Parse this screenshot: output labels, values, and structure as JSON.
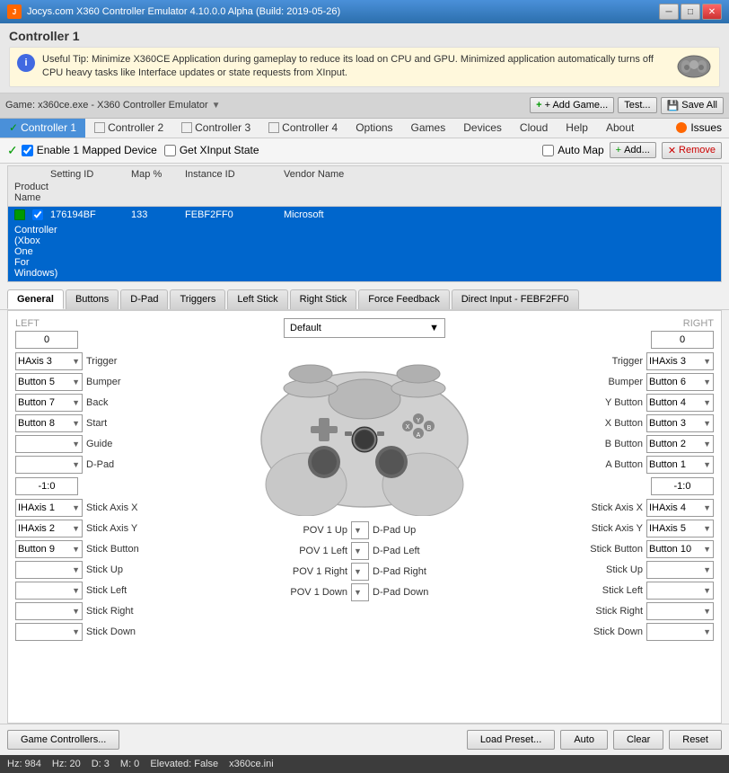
{
  "titleBar": {
    "title": "Jocys.com X360 Controller Emulator 4.10.0.0 Alpha (Build: 2019-05-26)",
    "minBtn": "─",
    "maxBtn": "□",
    "closeBtn": "✕"
  },
  "controllerHeader": {
    "title": "Controller 1",
    "tipText": "Useful Tip: Minimize X360CE Application during gameplay to reduce its load on CPU and GPU. Minimized application automatically turns off CPU heavy tasks like Interface updates or state requests from XInput.",
    "tipPrefix": "i"
  },
  "toolbar": {
    "gameLabel": "Game: x360ce.exe - X360 Controller Emulator",
    "addGameBtn": "+ Add Game...",
    "testBtn": "Test...",
    "saveAllBtn": "Save All"
  },
  "menuBar": {
    "items": [
      "Controller 1",
      "Controller 2",
      "Controller 3",
      "Controller 4",
      "Options",
      "Games",
      "Devices",
      "Cloud",
      "Help",
      "About"
    ],
    "issuesLabel": "Issues"
  },
  "actionBar": {
    "enableLabel": "Enable 1 Mapped Device",
    "getXInputLabel": "Get XInput State",
    "autoMapLabel": "Auto Map",
    "addLabel": "Add...",
    "removeLabel": "Remove"
  },
  "deviceTable": {
    "headers": [
      "",
      "",
      "Setting ID",
      "Map %",
      "Instance ID",
      "Vendor Name",
      "Product Name"
    ],
    "row": {
      "settingId": "176194BF",
      "mapPercent": "133",
      "instanceId": "FEBF2FF0",
      "vendorName": "Microsoft",
      "productName": "Controller (Xbox One For Windows)"
    }
  },
  "tabs": {
    "items": [
      "General",
      "Buttons",
      "D-Pad",
      "Triggers",
      "Left Stick",
      "Right Stick",
      "Force Feedback",
      "Direct Input - FEBF2FF0"
    ],
    "activeTab": "General"
  },
  "leftPanel": {
    "title": "LEFT",
    "inputValue": "0",
    "stickValue": "-1:0",
    "rows": [
      {
        "dropdown": "HAxis 3",
        "label": "Trigger"
      },
      {
        "dropdown": "Button 5",
        "label": "Bumper"
      },
      {
        "dropdown": "Button 7",
        "label": "Back"
      },
      {
        "dropdown": "Button 8",
        "label": "Start"
      },
      {
        "dropdown": "",
        "label": "Guide"
      },
      {
        "dropdown": "",
        "label": "D-Pad"
      },
      {
        "dropdown": "IHAxis 1",
        "label": "Stick Axis X"
      },
      {
        "dropdown": "IHAxis 2",
        "label": "Stick Axis Y"
      },
      {
        "dropdown": "Button 9",
        "label": "Stick Button"
      },
      {
        "dropdown": "",
        "label": "Stick Up"
      },
      {
        "dropdown": "",
        "label": "Stick Left"
      },
      {
        "dropdown": "",
        "label": "Stick Right"
      },
      {
        "dropdown": "",
        "label": "Stick Down"
      }
    ]
  },
  "centerPanel": {
    "defaultDropdown": "Default",
    "dpadRows": [
      {
        "label": "POV 1 Up",
        "value": "D-Pad Up"
      },
      {
        "label": "POV 1 Left",
        "value": "D-Pad Left"
      },
      {
        "label": "POV 1 Right",
        "value": "D-Pad Right"
      },
      {
        "label": "POV 1 Down",
        "value": "D-Pad Down"
      }
    ]
  },
  "rightPanel": {
    "title": "RIGHT",
    "inputValue": "0",
    "stickValue": "-1:0",
    "rows": [
      {
        "label": "Trigger",
        "dropdown": "IHAxis 3"
      },
      {
        "label": "Bumper",
        "dropdown": "Button 6"
      },
      {
        "label": "Y Button",
        "dropdown": "Button 4"
      },
      {
        "label": "X Button",
        "dropdown": "Button 3"
      },
      {
        "label": "B Button",
        "dropdown": "Button 2"
      },
      {
        "label": "A Button",
        "dropdown": "Button 1"
      },
      {
        "label": "Stick Axis X",
        "dropdown": "IHAxis 4"
      },
      {
        "label": "Stick Axis Y",
        "dropdown": "IHAxis 5"
      },
      {
        "label": "Stick Button",
        "dropdown": "Button 10"
      },
      {
        "label": "Stick Up",
        "dropdown": ""
      },
      {
        "label": "Stick Left",
        "dropdown": ""
      },
      {
        "label": "Stick Right",
        "dropdown": ""
      },
      {
        "label": "Stick Down",
        "dropdown": ""
      }
    ]
  },
  "bottomButtons": {
    "gameControllers": "Game Controllers...",
    "loadPreset": "Load Preset...",
    "auto": "Auto",
    "clear": "Clear",
    "reset": "Reset"
  },
  "statusBar": {
    "hz": "Hz: 984",
    "fps": "Hz: 20",
    "d": "D: 3",
    "m": "M: 0",
    "elevated": "Elevated: False",
    "file": "x360ce.ini"
  }
}
